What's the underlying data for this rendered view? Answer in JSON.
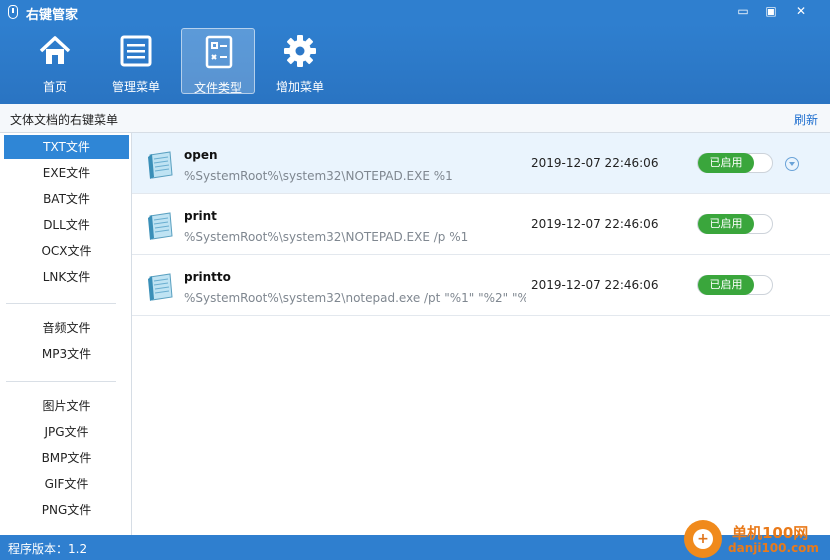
{
  "window": {
    "title": "右键管家",
    "minimize": "▭",
    "restore": "▣",
    "close": "✕"
  },
  "toolbar": [
    {
      "label": "首页",
      "icon": "home-icon"
    },
    {
      "label": "管理菜单",
      "icon": "menu-list-icon"
    },
    {
      "label": "文件类型",
      "icon": "file-type-icon",
      "active": true
    },
    {
      "label": "增加菜单",
      "icon": "gear-icon"
    }
  ],
  "subheader": {
    "title": "文体文档的右键菜单",
    "refresh": "刷新"
  },
  "sidebar": {
    "group1": [
      "TXT文件",
      "EXE文件",
      "BAT文件",
      "DLL文件",
      "OCX文件",
      "LNK文件"
    ],
    "group2": [
      "音频文件",
      "MP3文件"
    ],
    "group3": [
      "图片文件",
      "JPG文件",
      "BMP文件",
      "GIF文件",
      "PNG文件"
    ],
    "selected": "TXT文件"
  },
  "rows": [
    {
      "name": "open",
      "command": "%SystemRoot%\\system32\\NOTEPAD.EXE %1",
      "time": "2019-12-07 22:46:06",
      "status": "已启用"
    },
    {
      "name": "print",
      "command": "%SystemRoot%\\system32\\NOTEPAD.EXE /p %1",
      "time": "2019-12-07 22:46:06",
      "status": "已启用"
    },
    {
      "name": "printto",
      "command": "%SystemRoot%\\system32\\notepad.exe /pt \"%1\" \"%2\" \"%...",
      "time": "2019-12-07 22:46:06",
      "status": "已启用"
    }
  ],
  "statusbar": {
    "version": "程序版本：1.2"
  },
  "watermark": {
    "line1": "单机100网",
    "line2": "danji100.com"
  },
  "colors": {
    "titlebar": "#2f7fcf",
    "accent": "#2f86d6",
    "enabled": "#3aa63c"
  }
}
